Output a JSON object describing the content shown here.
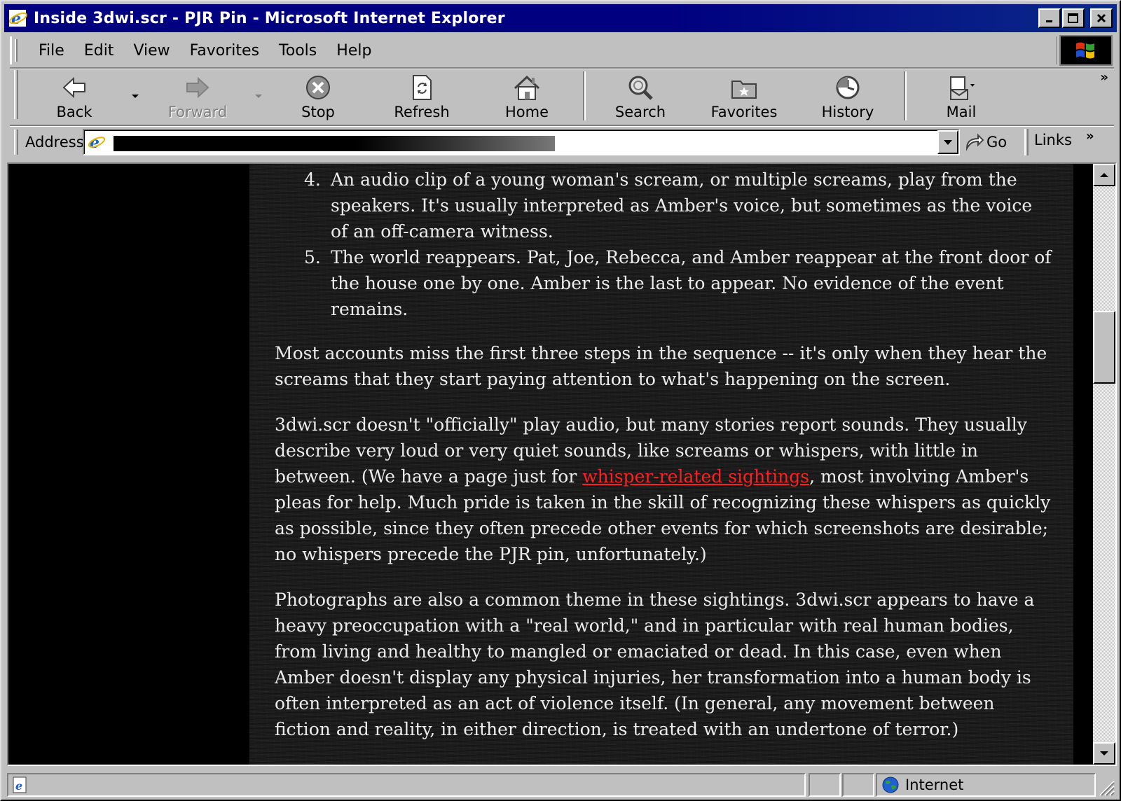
{
  "window": {
    "title": "Inside 3dwi.scr - PJR Pin - Microsoft Internet Explorer"
  },
  "menu": {
    "items": [
      {
        "id": "file",
        "label": "File"
      },
      {
        "id": "edit",
        "label": "Edit"
      },
      {
        "id": "view",
        "label": "View"
      },
      {
        "id": "favorites",
        "label": "Favorites"
      },
      {
        "id": "tools",
        "label": "Tools"
      },
      {
        "id": "help",
        "label": "Help"
      }
    ]
  },
  "toolbar": {
    "back": "Back",
    "forward": "Forward",
    "stop": "Stop",
    "refresh": "Refresh",
    "home": "Home",
    "search": "Search",
    "favorites": "Favorites",
    "history": "History",
    "mail": "Mail",
    "more": "»"
  },
  "address": {
    "label": "Address",
    "go": "Go",
    "links": "Links",
    "more": "»"
  },
  "content": {
    "list": [
      {
        "num": "4.",
        "text": "An audio clip of a young woman's scream, or multiple screams, play from the speakers. It's usually interpreted as Amber's voice, but sometimes as the voice of an off-camera witness."
      },
      {
        "num": "5.",
        "text": "The world reappears. Pat, Joe, Rebecca, and Amber reappear at the front door of the house one by one. Amber is the last to appear. No evidence of the event remains."
      }
    ],
    "para1": "Most accounts miss the first three steps in the sequence -- it's only when they hear the screams that they start paying attention to what's happening on the screen.",
    "para2_a": "3dwi.scr doesn't \"officially\" play audio, but many stories report sounds. They usually describe very loud or very quiet sounds, like screams or whispers, with little in between. (We have a page just for ",
    "para2_link": "whisper-related sightings",
    "para2_b": ", most involving Amber's pleas for help. Much pride is taken in the skill of recognizing these whispers as quickly as possible, since they often precede other events for which screenshots are desirable; no whispers precede the PJR pin, unfortunately.)",
    "para3": "Photographs are also a common theme in these sightings. 3dwi.scr appears to have a heavy preoccupation with a \"real world,\" and in particular with real human bodies, from living and healthy to mangled or emaciated or dead. In this case, even when Amber doesn't display any physical injuries, her transformation into a human body is often interpreted as an act of violence itself. (In general, any movement between fiction and reality, in either direction, is treated with an undertone of terror.)",
    "link_color": "#ff2020",
    "text_color": "#ececec"
  },
  "status": {
    "zone": "Internet"
  },
  "colors": {
    "titlebar": "#000080",
    "chrome": "#c0c0c0"
  }
}
